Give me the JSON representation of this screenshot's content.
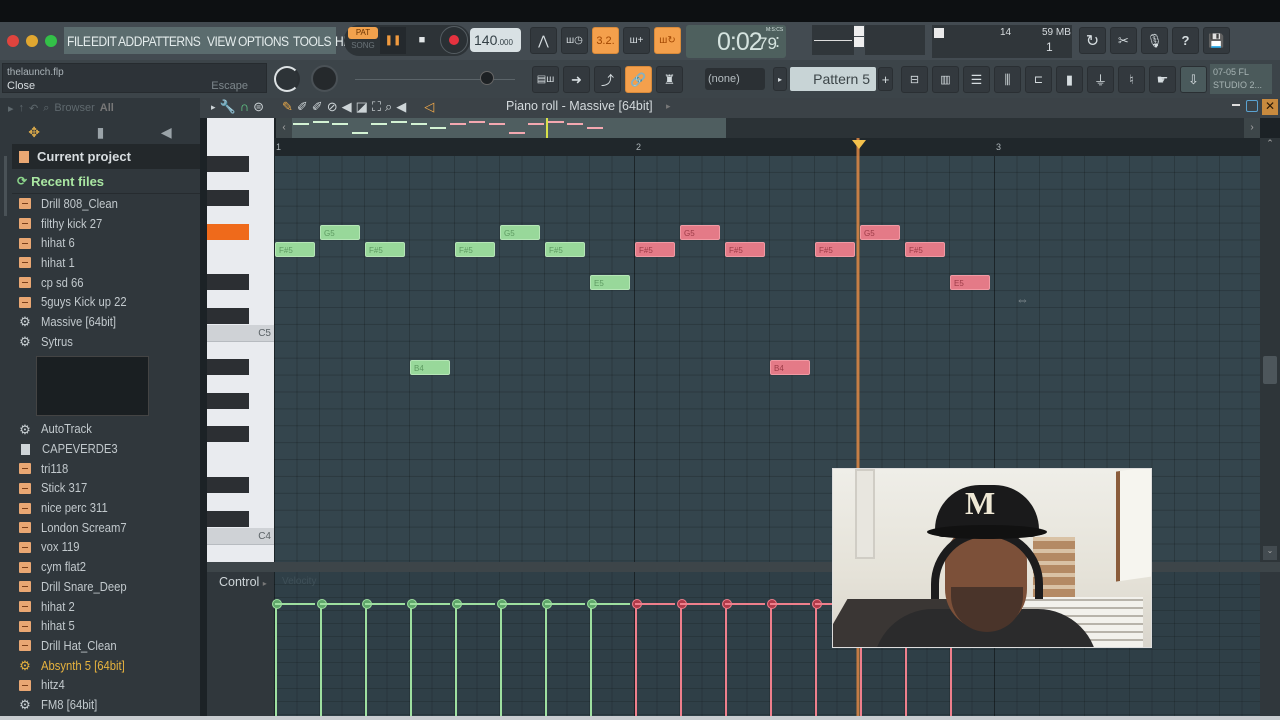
{
  "window": {
    "controls": [
      "close",
      "minimize",
      "maximize"
    ]
  },
  "menu": [
    "FILE",
    "EDIT",
    "ADD",
    "PATTERNS",
    "VIEW",
    "OPTIONS",
    "TOOLS",
    "HELP"
  ],
  "transport": {
    "mode_pat": "PAT",
    "mode_song": "SONG",
    "tempo": "140",
    "tempo_decimal": ".000",
    "time": "0:02",
    "time_cs": "79",
    "time_format": "M:S:CS"
  },
  "monitor": {
    "cpu": "14",
    "memory": "59 MB",
    "polyphony": "1"
  },
  "hint_bar": {
    "filename": "thelaunch.flp",
    "action": "Close",
    "shortcut": "Escape"
  },
  "toolbar2": {
    "channel_select": "(none)",
    "pattern": "Pattern 5",
    "news": "07-05  FL",
    "news2": "STUDIO 2..."
  },
  "browser": {
    "header": "Browser",
    "filter": "All",
    "folders": [
      {
        "label": "Current project",
        "icon": "folder-icon"
      },
      {
        "label": "Recent files",
        "icon": "recent-folder-icon"
      }
    ],
    "items": [
      {
        "label": "Drill 808_Clean",
        "type": "sample"
      },
      {
        "label": "filthy kick 27",
        "type": "sample"
      },
      {
        "label": "hihat 6",
        "type": "sample"
      },
      {
        "label": "hihat 1",
        "type": "sample"
      },
      {
        "label": "cp sd 66",
        "type": "sample"
      },
      {
        "label": "5guys Kick up 22",
        "type": "sample"
      },
      {
        "label": "Massive [64bit]",
        "type": "plugin"
      },
      {
        "label": "Sytrus",
        "type": "plugin"
      },
      {
        "label": "AutoTrack",
        "type": "plugin"
      },
      {
        "label": "CAPEVERDE3",
        "type": "project"
      },
      {
        "label": "tri118",
        "type": "sample"
      },
      {
        "label": "Stick 317",
        "type": "sample"
      },
      {
        "label": "nice perc 311",
        "type": "sample"
      },
      {
        "label": "London Scream7",
        "type": "sample"
      },
      {
        "label": "vox 119",
        "type": "sample"
      },
      {
        "label": "cym flat2",
        "type": "sample"
      },
      {
        "label": "Drill Snare_Deep",
        "type": "sample"
      },
      {
        "label": "hihat 2",
        "type": "sample"
      },
      {
        "label": "hihat 5",
        "type": "sample"
      },
      {
        "label": "Drill Hat_Clean",
        "type": "sample"
      },
      {
        "label": "Absynth 5 [64bit]",
        "type": "plugin-highlight"
      },
      {
        "label": "hitz4",
        "type": "sample"
      },
      {
        "label": "FM8 [64bit]",
        "type": "plugin"
      }
    ]
  },
  "piano_roll": {
    "title": "Piano roll - Massive [64bit]",
    "bars": [
      "1",
      "2",
      "3"
    ],
    "key_labels": [
      "C5",
      "C4"
    ],
    "highlighted_key": "F#5",
    "colors": {
      "green_note": "#98d89a",
      "pink_note": "#e47a87",
      "playhead": "#e98b45"
    },
    "notes": [
      {
        "pitch": "F#5",
        "start_step": 0,
        "len_steps": 2,
        "color": "green"
      },
      {
        "pitch": "G5",
        "start_step": 2,
        "len_steps": 2,
        "color": "green"
      },
      {
        "pitch": "F#5",
        "start_step": 4,
        "len_steps": 2,
        "color": "green"
      },
      {
        "pitch": "B4",
        "start_step": 6,
        "len_steps": 2,
        "color": "green"
      },
      {
        "pitch": "F#5",
        "start_step": 8,
        "len_steps": 2,
        "color": "green"
      },
      {
        "pitch": "G5",
        "start_step": 10,
        "len_steps": 2,
        "color": "green"
      },
      {
        "pitch": "F#5",
        "start_step": 12,
        "len_steps": 2,
        "color": "green"
      },
      {
        "pitch": "E5",
        "start_step": 14,
        "len_steps": 2,
        "color": "green"
      },
      {
        "pitch": "F#5",
        "start_step": 16,
        "len_steps": 2,
        "color": "pink"
      },
      {
        "pitch": "G5",
        "start_step": 18,
        "len_steps": 2,
        "color": "pink"
      },
      {
        "pitch": "F#5",
        "start_step": 20,
        "len_steps": 2,
        "color": "pink"
      },
      {
        "pitch": "B4",
        "start_step": 22,
        "len_steps": 2,
        "color": "pink"
      },
      {
        "pitch": "F#5",
        "start_step": 24,
        "len_steps": 2,
        "color": "pink"
      },
      {
        "pitch": "G5",
        "start_step": 26,
        "len_steps": 2,
        "color": "pink"
      },
      {
        "pitch": "F#5",
        "start_step": 28,
        "len_steps": 2,
        "color": "pink"
      },
      {
        "pitch": "E5",
        "start_step": 30,
        "len_steps": 2,
        "color": "pink"
      }
    ],
    "playhead_bar_position": 2.62
  },
  "control": {
    "label": "Control",
    "target": "Velocity"
  },
  "webcam": {
    "cap_letter": "M"
  }
}
